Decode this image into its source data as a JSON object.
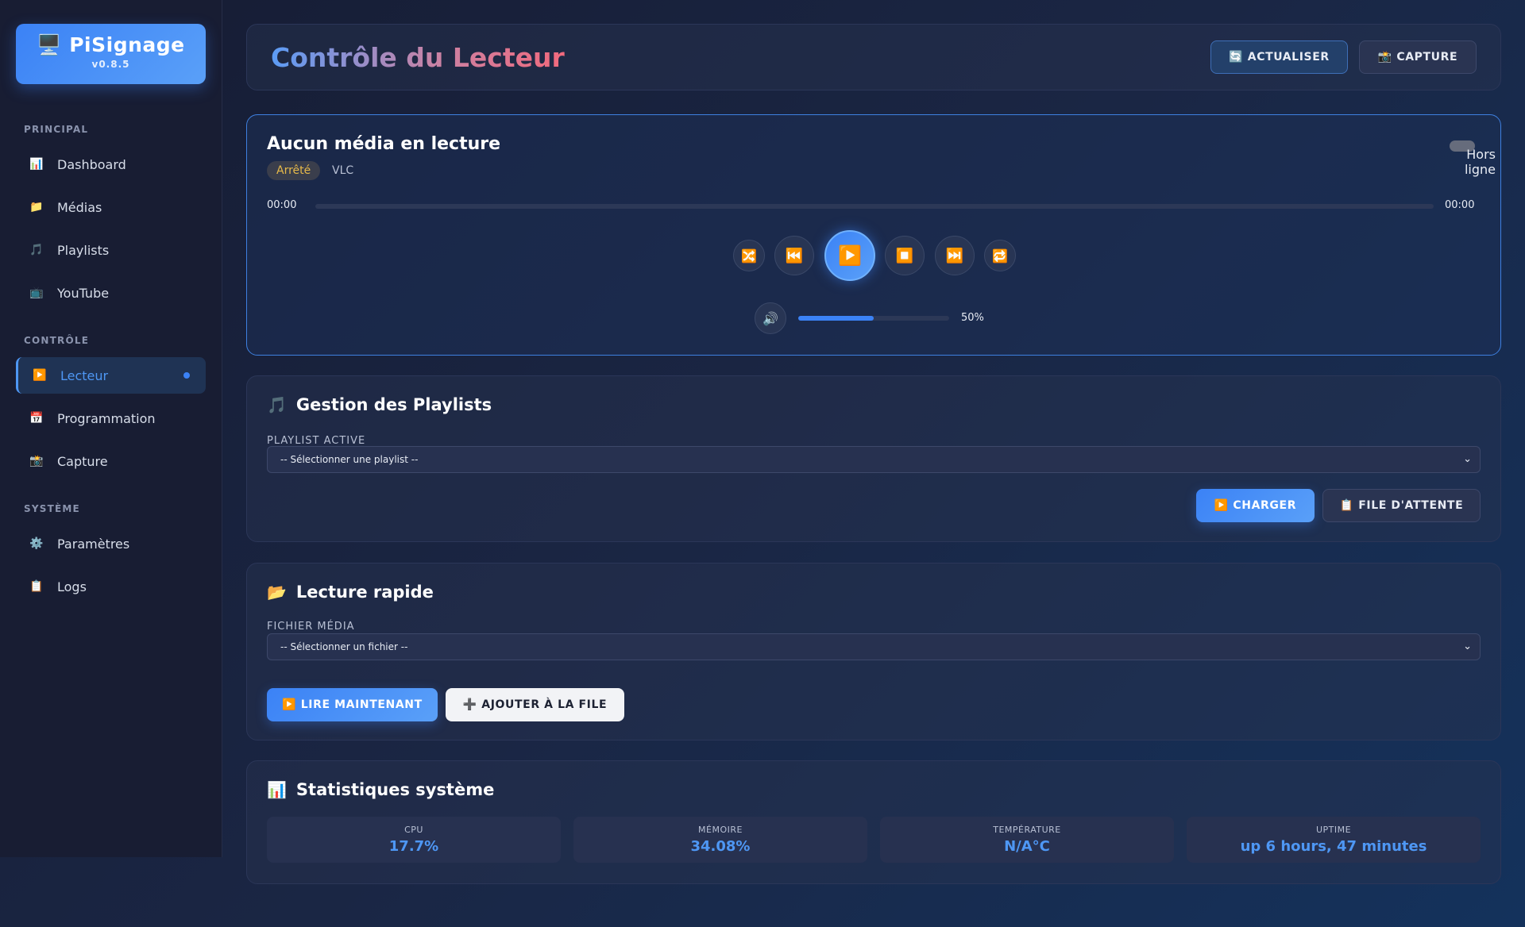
{
  "app": {
    "name": "PiSignage",
    "version": "v0.8.5",
    "logo_icon": "🖥️"
  },
  "sidebar": {
    "sections": [
      {
        "title": "PRINCIPAL",
        "items": [
          {
            "icon": "📊",
            "label": "Dashboard"
          },
          {
            "icon": "📁",
            "label": "Médias"
          },
          {
            "icon": "🎵",
            "label": "Playlists"
          },
          {
            "icon": "📺",
            "label": "YouTube"
          }
        ]
      },
      {
        "title": "CONTRÔLE",
        "items": [
          {
            "icon": "▶️",
            "label": "Lecteur",
            "active": true
          },
          {
            "icon": "📅",
            "label": "Programmation"
          },
          {
            "icon": "📸",
            "label": "Capture"
          }
        ]
      },
      {
        "title": "SYSTÈME",
        "items": [
          {
            "icon": "⚙️",
            "label": "Paramètres"
          },
          {
            "icon": "📋",
            "label": "Logs"
          }
        ]
      }
    ]
  },
  "header": {
    "title": "Contrôle du Lecteur",
    "refresh_label": "🔄 ACTUALISER",
    "capture_label": "📸 CAPTURE"
  },
  "player": {
    "now_playing": "Aucun média en lecture",
    "state": "Arrêté",
    "engine": "VLC",
    "connection": "Hors ligne",
    "time_current": "00:00",
    "time_total": "00:00",
    "progress": 0,
    "controls": {
      "shuffle": "🔀",
      "previous": "⏮️",
      "play": "▶️",
      "stop": "⏹️",
      "next": "⏭️",
      "repeat": "🔁"
    },
    "volume_icon": "🔊",
    "volume_percent": 50,
    "volume_text": "50%"
  },
  "playlists": {
    "icon": "🎵",
    "title": "Gestion des Playlists",
    "field_label": "PLAYLIST ACTIVE",
    "select_value": "-- Sélectionner une playlist --",
    "load_label": "▶️ CHARGER",
    "queue_label": "📋 FILE D'ATTENTE"
  },
  "quick_play": {
    "icon": "📂",
    "title": "Lecture rapide",
    "field_label": "FICHIER MÉDIA",
    "select_value": "-- Sélectionner un fichier --",
    "play_now_label": "▶️ LIRE MAINTENANT",
    "add_queue_label": "➕ AJOUTER À LA FILE"
  },
  "stats": {
    "icon": "📊",
    "title": "Statistiques système",
    "items": [
      {
        "label": "CPU",
        "value": "17.7%"
      },
      {
        "label": "MÉMOIRE",
        "value": "34.08%"
      },
      {
        "label": "TEMPÉRATURE",
        "value": "N/A°C"
      },
      {
        "label": "UPTIME",
        "value": "up 6 hours, 47 minutes"
      }
    ]
  },
  "colors": {
    "accent": "#3b82f6",
    "warning": "#e6b94a",
    "background": "#161c33"
  }
}
